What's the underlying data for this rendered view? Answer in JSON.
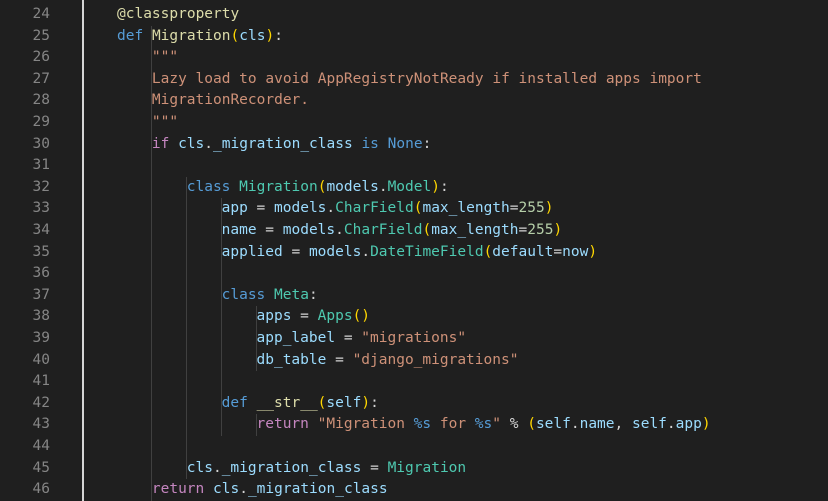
{
  "editor": {
    "lines": [
      {
        "n": "24",
        "indent": 1,
        "tokens": [
          [
            "@classproperty",
            "t-dec"
          ]
        ]
      },
      {
        "n": "25",
        "indent": 1,
        "tokens": [
          [
            "def",
            "t-kw"
          ],
          [
            " ",
            "t-txt"
          ],
          [
            "Migration",
            "t-fn"
          ],
          [
            "(",
            "t-br1"
          ],
          [
            "cls",
            "t-var"
          ],
          [
            ")",
            "t-br1"
          ],
          [
            ":",
            "t-txt"
          ]
        ]
      },
      {
        "n": "26",
        "indent": 2,
        "tokens": [
          [
            "\"\"\"",
            "t-str"
          ]
        ]
      },
      {
        "n": "27",
        "indent": 2,
        "tokens": [
          [
            "Lazy load to avoid AppRegistryNotReady if installed apps import",
            "t-str"
          ]
        ]
      },
      {
        "n": "28",
        "indent": 2,
        "tokens": [
          [
            "MigrationRecorder.",
            "t-str"
          ]
        ]
      },
      {
        "n": "29",
        "indent": 2,
        "tokens": [
          [
            "\"\"\"",
            "t-str"
          ]
        ]
      },
      {
        "n": "30",
        "indent": 2,
        "tokens": [
          [
            "if",
            "t-ctl"
          ],
          [
            " ",
            "t-txt"
          ],
          [
            "cls",
            "t-var"
          ],
          [
            ".",
            "t-txt"
          ],
          [
            "_migration_class",
            "t-var"
          ],
          [
            " ",
            "t-txt"
          ],
          [
            "is",
            "t-kw"
          ],
          [
            " ",
            "t-txt"
          ],
          [
            "None",
            "t-kw"
          ],
          [
            ":",
            "t-txt"
          ]
        ]
      },
      {
        "n": "31",
        "indent": 0,
        "tokens": []
      },
      {
        "n": "32",
        "indent": 3,
        "tokens": [
          [
            "class",
            "t-kw"
          ],
          [
            " ",
            "t-txt"
          ],
          [
            "Migration",
            "t-cls"
          ],
          [
            "(",
            "t-br1"
          ],
          [
            "models",
            "t-var"
          ],
          [
            ".",
            "t-txt"
          ],
          [
            "Model",
            "t-cls"
          ],
          [
            ")",
            "t-br1"
          ],
          [
            ":",
            "t-txt"
          ]
        ]
      },
      {
        "n": "33",
        "indent": 4,
        "tokens": [
          [
            "app",
            "t-var"
          ],
          [
            " = ",
            "t-op"
          ],
          [
            "models",
            "t-var"
          ],
          [
            ".",
            "t-txt"
          ],
          [
            "CharField",
            "t-cls"
          ],
          [
            "(",
            "t-br1"
          ],
          [
            "max_length",
            "t-var"
          ],
          [
            "=",
            "t-op"
          ],
          [
            "255",
            "t-num"
          ],
          [
            ")",
            "t-br1"
          ]
        ]
      },
      {
        "n": "34",
        "indent": 4,
        "tokens": [
          [
            "name",
            "t-var"
          ],
          [
            " = ",
            "t-op"
          ],
          [
            "models",
            "t-var"
          ],
          [
            ".",
            "t-txt"
          ],
          [
            "CharField",
            "t-cls"
          ],
          [
            "(",
            "t-br1"
          ],
          [
            "max_length",
            "t-var"
          ],
          [
            "=",
            "t-op"
          ],
          [
            "255",
            "t-num"
          ],
          [
            ")",
            "t-br1"
          ]
        ]
      },
      {
        "n": "35",
        "indent": 4,
        "tokens": [
          [
            "applied",
            "t-var"
          ],
          [
            " = ",
            "t-op"
          ],
          [
            "models",
            "t-var"
          ],
          [
            ".",
            "t-txt"
          ],
          [
            "DateTimeField",
            "t-cls"
          ],
          [
            "(",
            "t-br1"
          ],
          [
            "default",
            "t-var"
          ],
          [
            "=",
            "t-op"
          ],
          [
            "now",
            "t-var"
          ],
          [
            ")",
            "t-br1"
          ]
        ]
      },
      {
        "n": "36",
        "indent": 0,
        "tokens": []
      },
      {
        "n": "37",
        "indent": 4,
        "tokens": [
          [
            "class",
            "t-kw"
          ],
          [
            " ",
            "t-txt"
          ],
          [
            "Meta",
            "t-cls"
          ],
          [
            ":",
            "t-txt"
          ]
        ]
      },
      {
        "n": "38",
        "indent": 5,
        "tokens": [
          [
            "apps",
            "t-var"
          ],
          [
            " = ",
            "t-op"
          ],
          [
            "Apps",
            "t-cls"
          ],
          [
            "()",
            "t-br1"
          ]
        ]
      },
      {
        "n": "39",
        "indent": 5,
        "tokens": [
          [
            "app_label",
            "t-var"
          ],
          [
            " = ",
            "t-op"
          ],
          [
            "\"migrations\"",
            "t-str"
          ]
        ]
      },
      {
        "n": "40",
        "indent": 5,
        "tokens": [
          [
            "db_table",
            "t-var"
          ],
          [
            " = ",
            "t-op"
          ],
          [
            "\"django_migrations\"",
            "t-str"
          ]
        ]
      },
      {
        "n": "41",
        "indent": 0,
        "tokens": []
      },
      {
        "n": "42",
        "indent": 4,
        "tokens": [
          [
            "def",
            "t-kw"
          ],
          [
            " ",
            "t-txt"
          ],
          [
            "__str__",
            "t-fn"
          ],
          [
            "(",
            "t-br1"
          ],
          [
            "self",
            "t-var"
          ],
          [
            ")",
            "t-br1"
          ],
          [
            ":",
            "t-txt"
          ]
        ]
      },
      {
        "n": "43",
        "indent": 5,
        "tokens": [
          [
            "return",
            "t-ctl"
          ],
          [
            " ",
            "t-txt"
          ],
          [
            "\"Migration ",
            "t-str"
          ],
          [
            "%s",
            "t-fmt"
          ],
          [
            " for ",
            "t-str"
          ],
          [
            "%s",
            "t-fmt"
          ],
          [
            "\"",
            "t-str"
          ],
          [
            " % ",
            "t-op"
          ],
          [
            "(",
            "t-br1"
          ],
          [
            "self",
            "t-var"
          ],
          [
            ".",
            "t-txt"
          ],
          [
            "name",
            "t-var"
          ],
          [
            ", ",
            "t-txt"
          ],
          [
            "self",
            "t-var"
          ],
          [
            ".",
            "t-txt"
          ],
          [
            "app",
            "t-var"
          ],
          [
            ")",
            "t-br1"
          ]
        ]
      },
      {
        "n": "44",
        "indent": 0,
        "tokens": []
      },
      {
        "n": "45",
        "indent": 3,
        "tokens": [
          [
            "cls",
            "t-var"
          ],
          [
            ".",
            "t-txt"
          ],
          [
            "_migration_class",
            "t-var"
          ],
          [
            " = ",
            "t-op"
          ],
          [
            "Migration",
            "t-cls"
          ]
        ]
      },
      {
        "n": "46",
        "indent": 2,
        "tokens": [
          [
            "return",
            "t-ctl"
          ],
          [
            " ",
            "t-txt"
          ],
          [
            "cls",
            "t-var"
          ],
          [
            ".",
            "t-txt"
          ],
          [
            "_migration_class",
            "t-var"
          ]
        ]
      }
    ]
  }
}
